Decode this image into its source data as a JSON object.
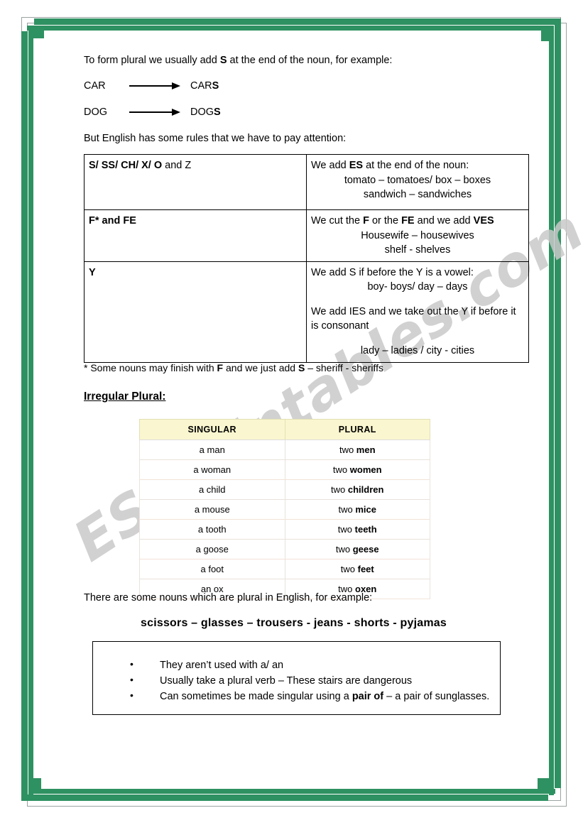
{
  "page": {
    "frame_color": "#2e9161",
    "watermark": "ESLprintables.com"
  },
  "intro": {
    "text_before": "To form plural we usually add ",
    "bold": "S",
    "text_after": " at the end of the noun, for example:"
  },
  "examples": [
    {
      "singular": "CAR",
      "plural_stem": "CAR",
      "plural_suffix": "S"
    },
    {
      "singular": "DOG",
      "plural_stem": "DOG",
      "plural_suffix": "S"
    }
  ],
  "rules_lead": "But English has some rules that we have to pay attention:",
  "rules_table": {
    "rows": [
      {
        "trigger_bold": "S/ SS/ CH/ X/ O",
        "trigger_rest": " and Z",
        "rule_intro_a": "We add ",
        "rule_intro_b": "ES",
        "rule_intro_c": " at the end of the noun:",
        "examples": [
          "tomato – tomatoes/ box – boxes",
          "sandwich – sandwiches"
        ]
      },
      {
        "trigger_bold": "F* and FE",
        "trigger_rest": "",
        "rule_intro_a": "We cut the ",
        "rule_intro_b": "F",
        "rule_intro_c": " or the ",
        "rule_intro_d": "FE",
        "rule_intro_e": " and we add  ",
        "rule_intro_f": "VES",
        "examples": [
          "Housewife – housewives",
          "shelf - shelves"
        ]
      },
      {
        "trigger_bold": "Y",
        "trigger_rest": "",
        "rule_line_1": "We add S if before the Y is a vowel:",
        "example_1": "boy- boys/ day – days",
        "rule_line_2": "We add IES and we take out the Y if before it is consonant",
        "example_2": "lady – ladies / city - cities"
      }
    ]
  },
  "footnote": {
    "star": "*",
    "text_a": " Some nouns may finish with ",
    "bold_f": "F",
    "text_b": " and we just add ",
    "bold_s": "S",
    "text_c": " – sheriff - sheriffs"
  },
  "section_heading": "Irregular Plural:",
  "irregular_table": {
    "headers": [
      "SINGULAR",
      "PLURAL"
    ],
    "rows": [
      {
        "singular": "a man",
        "plural_prefix": "two ",
        "plural_bold": "men"
      },
      {
        "singular": "a woman",
        "plural_prefix": "two ",
        "plural_bold": "women"
      },
      {
        "singular": "a child",
        "plural_prefix": "two ",
        "plural_bold": "children"
      },
      {
        "singular": "a mouse",
        "plural_prefix": "two ",
        "plural_bold": "mice"
      },
      {
        "singular": "a tooth",
        "plural_prefix": "two ",
        "plural_bold": "teeth"
      },
      {
        "singular": "a goose",
        "plural_prefix": "two ",
        "plural_bold": "geese"
      },
      {
        "singular": "a foot",
        "plural_prefix": "two ",
        "plural_bold": "feet"
      },
      {
        "singular": "an ox",
        "plural_prefix": "two ",
        "plural_bold": "oxen"
      }
    ]
  },
  "plural_lead": "There are some nouns which are plural in English, for example:",
  "plural_only_nouns": "scissors – glasses – trousers -  jeans -  shorts -  pyjamas",
  "notes": {
    "items": [
      {
        "text": "They aren’t used with a/ an"
      },
      {
        "text": "Usually take a plural verb – These stairs are dangerous"
      },
      {
        "text_a": "Can sometimes be made singular using a ",
        "bold": "pair of",
        "text_b": " – a pair of sunglasses."
      }
    ]
  }
}
